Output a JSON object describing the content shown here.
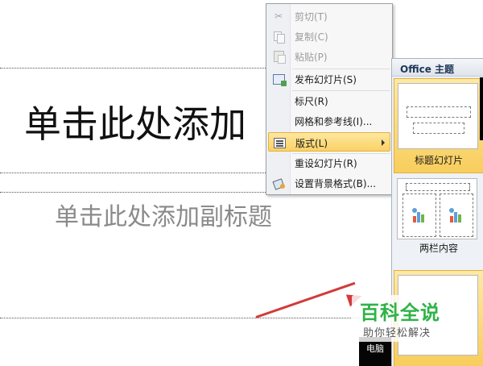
{
  "slide": {
    "title_placeholder": "单击此处添加",
    "subtitle_placeholder": "单击此处添加副标题"
  },
  "context_menu": {
    "items": [
      {
        "label": "剪切(T)",
        "icon": "scissors-icon",
        "enabled": false
      },
      {
        "label": "复制(C)",
        "icon": "copy-icon",
        "enabled": false
      },
      {
        "label": "粘贴(P)",
        "icon": "paste-icon",
        "enabled": false
      },
      {
        "label": "发布幻灯片(S)",
        "icon": "publish-slides-icon",
        "enabled": true
      },
      {
        "label": "标尺(R)",
        "icon": "",
        "enabled": true
      },
      {
        "label": "网格和参考线(I)...",
        "icon": "",
        "enabled": true
      },
      {
        "label": "版式(L)",
        "icon": "layout-icon",
        "enabled": true,
        "highlighted": true,
        "submenu": true
      },
      {
        "label": "重设幻灯片(R)",
        "icon": "",
        "enabled": true
      },
      {
        "label": "设置背景格式(B)...",
        "icon": "background-format-icon",
        "enabled": true
      }
    ]
  },
  "layout_gallery": {
    "header": "Office 主题",
    "layouts": [
      {
        "label": "标题幻灯片",
        "selected": true
      },
      {
        "label": "两栏内容",
        "selected": false
      },
      {
        "label": "",
        "selected": true
      }
    ]
  },
  "watermark": {
    "brand": "百科全说",
    "tagline": "助你轻松解决",
    "partial_text": "电脑"
  },
  "colors": {
    "menu_highlight": "#fbd264",
    "watermark_green": "#2fb346",
    "arrow_red": "#d23a3a",
    "gallery_header_text": "#1f3657"
  }
}
